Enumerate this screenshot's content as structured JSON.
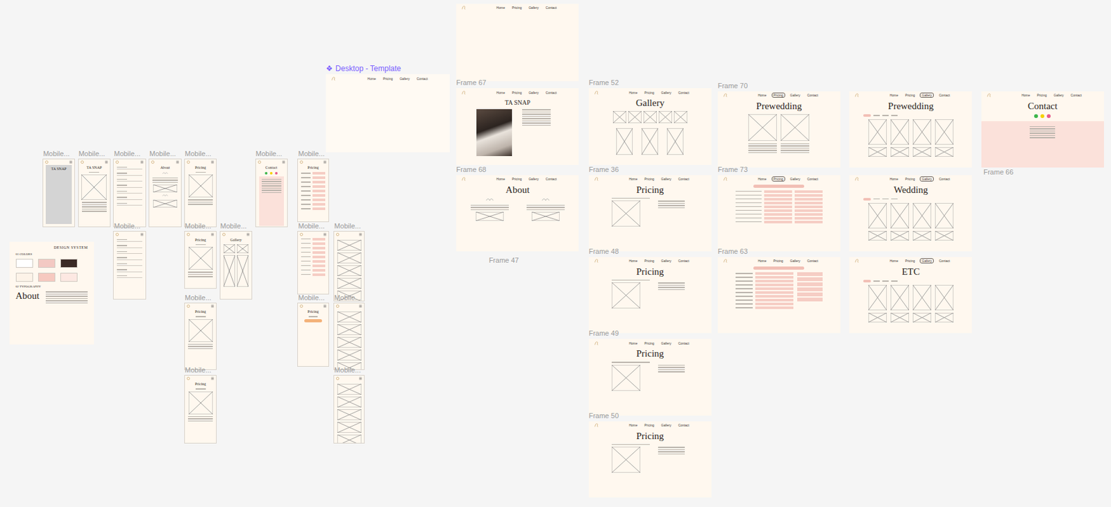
{
  "nav_items": [
    "Home",
    "Pricing",
    "Gallery",
    "Contact"
  ],
  "mobile_frames": [
    {
      "label": "Mobile...",
      "title": "TA SNAP",
      "kind": "splash"
    },
    {
      "label": "Mobile...",
      "title": "TA SNAP",
      "kind": "home"
    },
    {
      "label": "Mobile...",
      "title": "",
      "kind": "menu"
    },
    {
      "label": "Mobile...",
      "title": "About",
      "kind": "about"
    },
    {
      "label": "Mobile...",
      "title": "Pricing",
      "kind": "pricing"
    },
    {
      "label": "Mobile...",
      "title": "Contact",
      "kind": "contact"
    },
    {
      "label": "Mobile...",
      "title": "Pricing",
      "kind": "table"
    },
    {
      "label": "Mobile...",
      "title": "",
      "kind": "menu"
    },
    {
      "label": "Mobile...",
      "title": "Pricing",
      "kind": "pricing"
    },
    {
      "label": "Mobile...",
      "title": "Gallery",
      "kind": "gallery"
    },
    {
      "label": "Mobile...",
      "title": "",
      "kind": "table"
    },
    {
      "label": "Mobile...",
      "title": "",
      "kind": "list"
    },
    {
      "label": "Mobile...",
      "title": "Pricing",
      "kind": "pricing"
    },
    {
      "label": "Mobile...",
      "title": "Pricing",
      "kind": "button"
    },
    {
      "label": "Mobile...",
      "title": "",
      "kind": "list"
    },
    {
      "label": "Mobile...",
      "title": "Pricing",
      "kind": "pricing"
    },
    {
      "label": "Mobile...",
      "title": "",
      "kind": "list"
    }
  ],
  "desktop_frames": [
    {
      "label": "Desktop - Template",
      "icon": "❖",
      "component": true,
      "title": "",
      "kind": "empty",
      "active_nav": ""
    },
    {
      "label": "",
      "component": false,
      "title": "",
      "kind": "empty",
      "active_nav": ""
    },
    {
      "label": "Frame 67",
      "component": false,
      "title": "TA SNAP",
      "kind": "hero",
      "active_nav": ""
    },
    {
      "label": "Frame 68",
      "component": false,
      "title": "About",
      "kind": "about",
      "active_nav": ""
    },
    {
      "label": "Frame 52",
      "component": false,
      "title": "Gallery",
      "kind": "gallery",
      "active_nav": ""
    },
    {
      "label": "Frame 36",
      "component": false,
      "title": "Pricing",
      "kind": "pricing",
      "active_nav": ""
    },
    {
      "label": "Frame 48",
      "component": false,
      "title": "Pricing",
      "kind": "pricing",
      "active_nav": ""
    },
    {
      "label": "Frame 49",
      "component": false,
      "title": "Pricing",
      "kind": "pricing",
      "active_nav": ""
    },
    {
      "label": "Frame 50",
      "component": false,
      "title": "Pricing",
      "kind": "pricing",
      "active_nav": ""
    },
    {
      "label": "Frame 70",
      "component": false,
      "title": "Prewedding",
      "kind": "pair",
      "active_nav": "Pricing"
    },
    {
      "label": "Frame 73",
      "component": false,
      "title": "",
      "kind": "table",
      "active_nav": "Pricing"
    },
    {
      "label": "Frame 63",
      "component": false,
      "title": "",
      "kind": "table2",
      "active_nav": ""
    },
    {
      "label": "",
      "component": false,
      "title": "Prewedding",
      "kind": "grid",
      "active_nav": "Gallery"
    },
    {
      "label": "",
      "component": false,
      "title": "Wedding",
      "kind": "grid",
      "active_nav": "Gallery"
    },
    {
      "label": "",
      "component": false,
      "title": "ETC",
      "kind": "grid",
      "active_nav": "Gallery"
    },
    {
      "label": "",
      "component": false,
      "title": "Contact",
      "kind": "contact",
      "active_nav": ""
    }
  ],
  "stray_labels": [
    "Frame 47",
    "Frame 66"
  ],
  "design_system": {
    "title": "DESIGN SYSTEM",
    "colors_heading": "01 COLORS",
    "swatches": [
      {
        "color": "#ffffff"
      },
      {
        "color": "#f3c9c3"
      },
      {
        "color": "#3a2a26"
      },
      {
        "color": "#fdf3e8"
      },
      {
        "color": "#f6c9c0"
      },
      {
        "color": "#fde8e2"
      }
    ],
    "type_heading": "02 TYPOGRAPHY",
    "type_sample": "About"
  }
}
